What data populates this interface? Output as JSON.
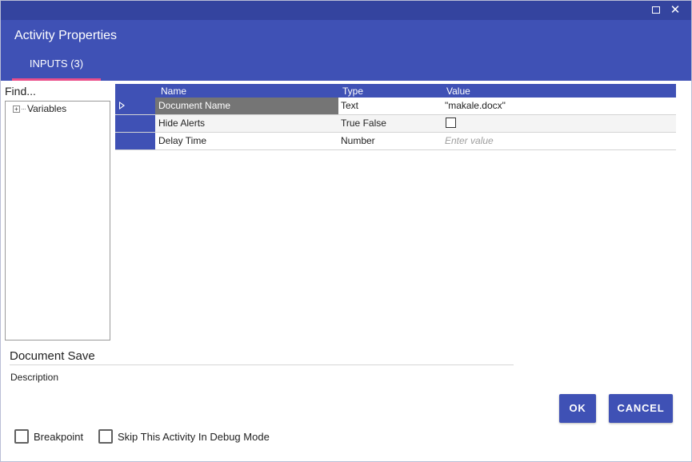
{
  "window": {
    "title": "Activity Properties",
    "maximize_icon": "maximize-icon",
    "close_icon": "close-icon",
    "close_glyph": "✕"
  },
  "tabs": [
    {
      "label": "INPUTS (3)",
      "active": true
    }
  ],
  "left_panel": {
    "find_label": "Find...",
    "tree": [
      {
        "label": "Variables",
        "expander": "+"
      }
    ]
  },
  "grid": {
    "columns": [
      "Name",
      "Type",
      "Value"
    ],
    "rows": [
      {
        "name": "Document Name",
        "type": "Text",
        "value": "\"makale.docx\"",
        "selected": true
      },
      {
        "name": "Hide Alerts",
        "type": "True False",
        "value": "",
        "checkbox": true
      },
      {
        "name": "Delay Time",
        "type": "Number",
        "value": "",
        "placeholder": "Enter value"
      }
    ]
  },
  "activity": {
    "name": "Document Save",
    "description_label": "Description"
  },
  "buttons": {
    "ok": "OK",
    "cancel": "CANCEL"
  },
  "options": {
    "breakpoint": "Breakpoint",
    "skip_debug": "Skip This Activity In Debug Mode"
  },
  "colors": {
    "primary": "#3f51b5",
    "tab_indicator": "#e94e8a",
    "selected_cell": "#757575"
  }
}
